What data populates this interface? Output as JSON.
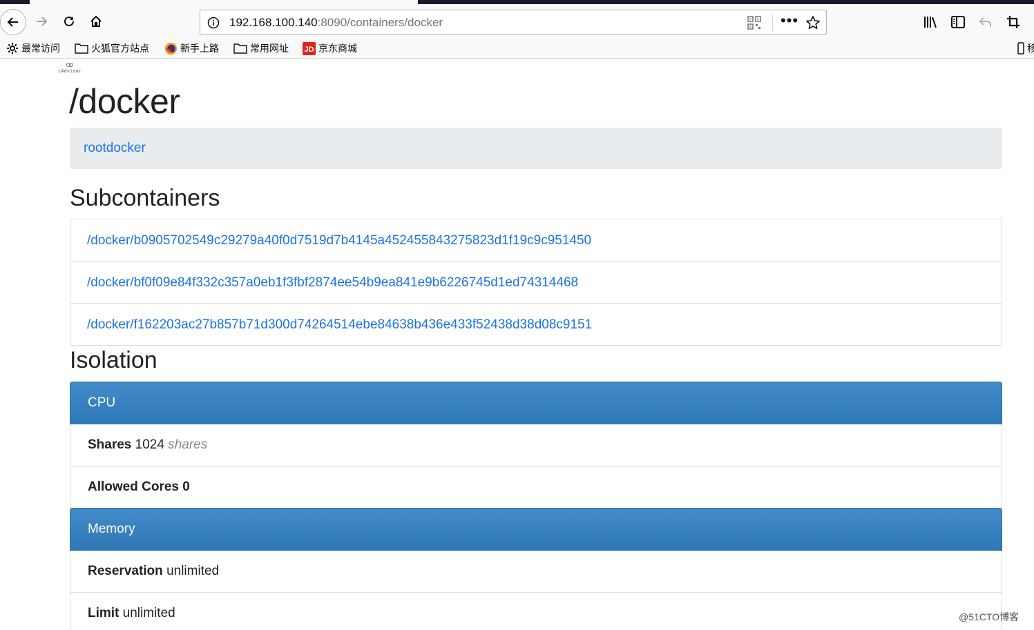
{
  "browser": {
    "url_host": "192.168.100.140",
    "url_path": ":8090/containers/docker",
    "bookmarks": [
      {
        "label": "最常访问",
        "icon": "gear-icon"
      },
      {
        "label": "火狐官方站点",
        "icon": "folder-icon"
      },
      {
        "label": "新手上路",
        "icon": "firefox-icon"
      },
      {
        "label": "常用网址",
        "icon": "folder-icon"
      },
      {
        "label": "京东商城",
        "icon": "jd-icon"
      }
    ],
    "bookmark_overflow": "移"
  },
  "page": {
    "logo_text": "cAdvisor",
    "title": "/docker",
    "breadcrumb": {
      "root": "root",
      "current": "docker"
    },
    "subcontainers_heading": "Subcontainers",
    "subcontainers": [
      "/docker/b0905702549c29279a40f0d7519d7b4145a452455843275823d1f19c9c951450",
      "/docker/bf0f09e84f332c357a0eb1f3fbf2874ee54b9ea841e9b6226745d1ed74314468",
      "/docker/f162203ac27b857b71d300d74264514ebe84638b436e433f52438d38d08c9151"
    ],
    "isolation_heading": "Isolation",
    "cpu": {
      "heading": "CPU",
      "shares_label": "Shares",
      "shares_value": "1024",
      "shares_unit": "shares",
      "allowed_cores_label": "Allowed Cores",
      "allowed_cores_value": "0"
    },
    "memory": {
      "heading": "Memory",
      "reservation_label": "Reservation",
      "reservation_value": "unlimited",
      "limit_label": "Limit",
      "limit_value": "unlimited"
    }
  },
  "watermark": "@51CTO博客"
}
